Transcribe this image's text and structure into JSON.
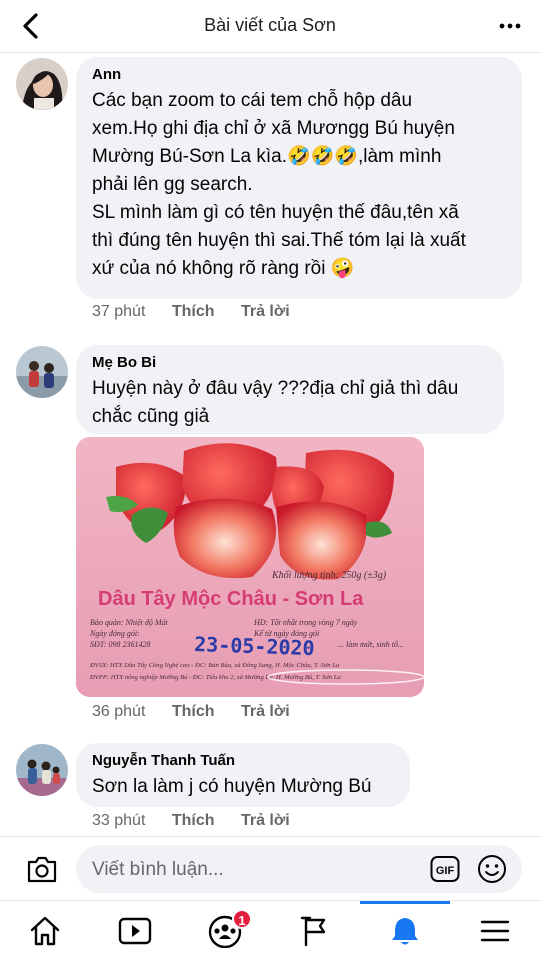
{
  "header": {
    "title": "Bài viết của Sơn",
    "back_icon": "chevron-left-icon",
    "more_icon": "more-horizontal-icon"
  },
  "comments": [
    {
      "name": "Ann",
      "text_lines": [
        "Các bạn  zoom to cái tem chỗ hộp dâu",
        "xem.Họ ghi địa chỉ ở xã Mươngg Bú huyện",
        "Mường Bú-Sơn La kìa.🤣🤣🤣,làm mình",
        "phải lên gg search.",
        "SL mình làm gì có tên huyện thế đâu,tên xã",
        "thì đúng tên huyện thì sai.Thế tóm lại là xuất",
        "xứ của nó không rõ ràng rồi 🤪"
      ],
      "time": "37 phút",
      "like": "Thích",
      "reply": "Trả lời"
    },
    {
      "name": "Mẹ Bo Bi",
      "text_lines": [
        "Huyện này ở đâu vậy ???địa chỉ giả thì dâu",
        "chắc cũng giả"
      ],
      "time": "36 phút",
      "like": "Thích",
      "reply": "Trả lời"
    },
    {
      "name": "Nguyễn Thanh Tuấn",
      "text_lines": [
        "Sơn la làm j có huyện Mường Bú"
      ],
      "time": "33 phút",
      "like": "Thích",
      "reply": "Trả lời"
    }
  ],
  "photo_label": {
    "weight": "Khối lượng tịnh: 250g (±3g)",
    "product": "Dâu Tây Mộc Châu - Sơn La",
    "storage": "Bảo quản: Nhiệt độ Mát",
    "pack_date": "Ngày đóng gói:",
    "phone": "SĐT: 098 2361428",
    "expiry": "HD: Tốt nhất trong vòng 7 ngày",
    "usage": "Kể từ ngày đóng gói",
    "use": "... làm mứt, sinh tố...",
    "stamp_date": "23-05-2020",
    "producer": "ĐVSX: HTX Dâu Tây Công Nghệ cao - ĐC: Bản Búa, xã Đông Sang, H. Mộc Châu, T. Sơn La",
    "distributor": "ĐVPP: HTX nông nghiệp Mường Bú - ĐC: Tiểu khu 2, xã Mường Bú, H. Mường Bú, T. Sơn La"
  },
  "input": {
    "placeholder": "Viết bình luận...",
    "gif_label": "GIF"
  },
  "nav": {
    "tabs": [
      "home-icon",
      "watch-icon",
      "groups-icon",
      "pages-flag-icon",
      "notifications-bell-icon",
      "menu-icon"
    ],
    "badge": "1",
    "active_tab": "notifications-bell-icon"
  },
  "colors": {
    "accent": "#1877f2",
    "bubble": "#f0f2f5",
    "badge": "#e41e3f"
  }
}
